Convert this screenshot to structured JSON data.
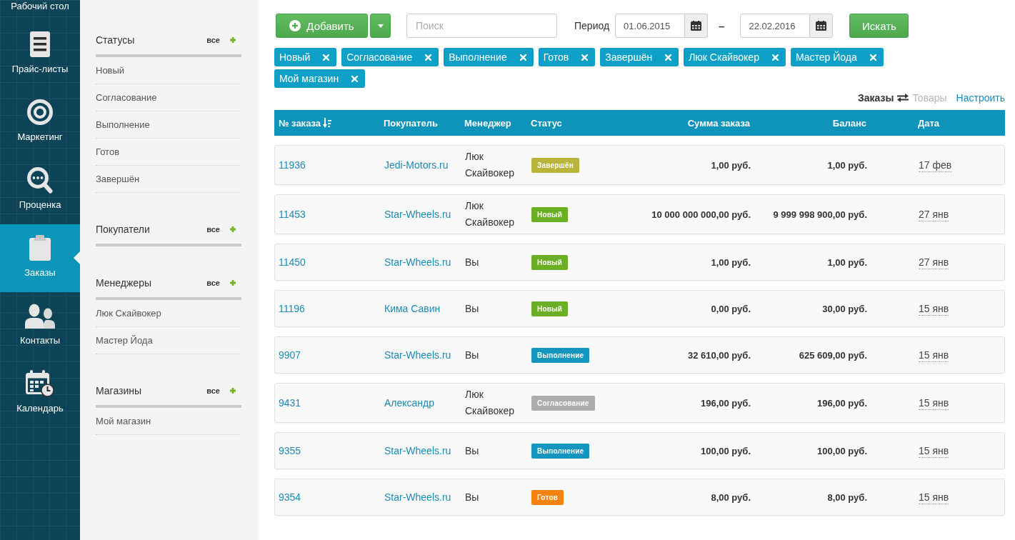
{
  "nav": {
    "items": [
      {
        "label": "Рабочий стол",
        "selected": false
      },
      {
        "label": "Прайс-листы",
        "selected": false
      },
      {
        "label": "Маркетинг",
        "selected": false
      },
      {
        "label": "Проценка",
        "selected": false
      },
      {
        "label": "Заказы",
        "selected": true
      },
      {
        "label": "Контакты",
        "selected": false
      },
      {
        "label": "Календарь",
        "selected": false
      }
    ]
  },
  "filters": {
    "sections": [
      {
        "title": "Статусы",
        "all_label": "все",
        "items": [
          "Новый",
          "Согласование",
          "Выполнение",
          "Готов",
          "Завершён"
        ]
      },
      {
        "title": "Покупатели",
        "all_label": "все"
      },
      {
        "title": "Менеджеры",
        "all_label": "все",
        "items": [
          "Люк Скайвокер",
          "Мастер Йода"
        ]
      },
      {
        "title": "Магазины",
        "all_label": "все",
        "items": [
          "Мой магазин"
        ]
      }
    ]
  },
  "toolbar": {
    "add_button": "Добавить",
    "search": {
      "placeholder": "Поиск"
    },
    "period_label": "Период",
    "date_from": "01.06.2015",
    "date_separator": "–",
    "date_to": "22.02.2016",
    "search_button": "Искать"
  },
  "active_filters": [
    "Новый",
    "Согласование",
    "Выполнение",
    "Готов",
    "Завершён",
    "Люк Скайвокер",
    "Мастер Йода",
    "Мой магазин"
  ],
  "view_switch": {
    "options": [
      {
        "label": "Заказы",
        "selected": true
      },
      {
        "label": "Товары",
        "selected": false
      }
    ],
    "settings_link": "Настроить"
  },
  "table": {
    "columns": [
      {
        "label": "№ заказа",
        "sorted": true
      },
      {
        "label": "Покупатель",
        "sorted": false
      },
      {
        "label": "Менеджер",
        "sorted": false
      },
      {
        "label": "Статус",
        "sorted": false
      },
      {
        "label": "Сумма заказа",
        "sorted": false
      },
      {
        "label": "Баланс",
        "sorted": false
      },
      {
        "label": "Дата",
        "sorted": false
      }
    ],
    "rows": [
      {
        "number": "11936",
        "customer": "Jedi-Motors.ru",
        "manager": "Люк Скайвокер",
        "status": {
          "label": "Завершён",
          "color": "#b8b43c"
        },
        "total": "1,00 руб.",
        "balance": "1,00 руб.",
        "date": "17 фев"
      },
      {
        "number": "11453",
        "customer": "Star-Wheels.ru",
        "manager": "Люк Скайвокер",
        "status": {
          "label": "Новый",
          "color": "#6aaf24"
        },
        "total": "10 000 000 000,00 руб.",
        "balance": "9 999 998 900,00 руб.",
        "date": "27 янв"
      },
      {
        "number": "11450",
        "customer": "Star-Wheels.ru",
        "manager": "Вы",
        "status": {
          "label": "Новый",
          "color": "#6aaf24"
        },
        "total": "1,00 руб.",
        "balance": "1,00 руб.",
        "date": "27 янв"
      },
      {
        "number": "11196",
        "customer": "Кима Савин",
        "manager": "Вы",
        "status": {
          "label": "Новый",
          "color": "#6aaf24"
        },
        "total": "0,00 руб.",
        "balance": "30,00 руб.",
        "date": "15 янв"
      },
      {
        "number": "9907",
        "customer": "Star-Wheels.ru",
        "manager": "Вы",
        "status": {
          "label": "Выполнение",
          "color": "#1496c0"
        },
        "total": "32 610,00 руб.",
        "balance": "625 609,00 руб.",
        "date": "15 янв"
      },
      {
        "number": "9431",
        "customer": "Александр",
        "manager": "Люк Скайвокер",
        "status": {
          "label": "Согласование",
          "color": "#adadad"
        },
        "total": "196,00 руб.",
        "balance": "196,00 руб.",
        "date": "15 янв"
      },
      {
        "number": "9355",
        "customer": "Star-Wheels.ru",
        "manager": "Вы",
        "status": {
          "label": "Выполнение",
          "color": "#1496c0"
        },
        "total": "100,00 руб.",
        "balance": "100,00 руб.",
        "date": "15 янв"
      },
      {
        "number": "9354",
        "customer": "Star-Wheels.ru",
        "manager": "Вы",
        "status": {
          "label": "Готов",
          "color": "#f5820f"
        },
        "total": "8,00 руб.",
        "balance": "8,00 руб.",
        "date": "15 янв"
      }
    ]
  }
}
